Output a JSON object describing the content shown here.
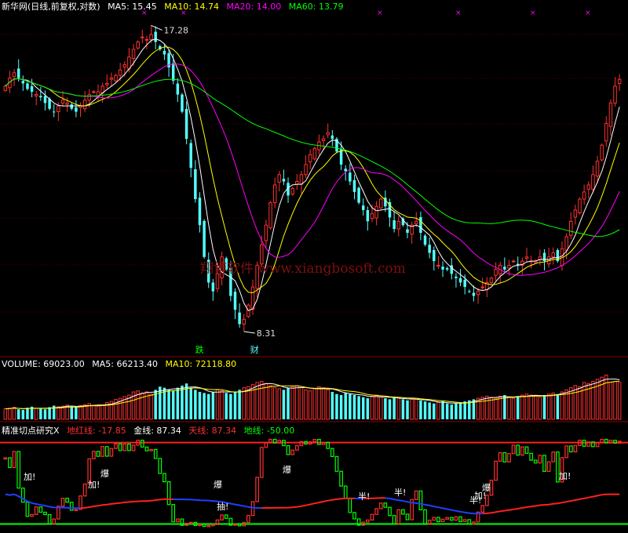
{
  "panels": {
    "price": {
      "title": "新华网(日线,前复权,对数)",
      "ma": [
        {
          "label": "MA5: 15.45",
          "color": "#ffffff"
        },
        {
          "label": "MA10: 14.74",
          "color": "#ffff00"
        },
        {
          "label": "MA20: 14.00",
          "color": "#ff00ff"
        },
        {
          "label": "MA60: 13.79",
          "color": "#00ff00"
        }
      ],
      "high_label": "17.28",
      "low_label": "8.31",
      "marker_die": "跌",
      "marker_cai": "财",
      "watermark": "翔博软件 www.xiangbosoft.com"
    },
    "volume": {
      "items": [
        {
          "label": "VOLUME: 69023.00",
          "color": "#ffffff"
        },
        {
          "label": "MA5: 66213.40",
          "color": "#ffffff"
        },
        {
          "label": "MA10: 72118.80",
          "color": "#ffff00"
        }
      ]
    },
    "indicator": {
      "items": [
        {
          "label": "精准切点研究X",
          "color": "#ffffff"
        },
        {
          "label": "地红线: -17.85",
          "color": "#ff3030"
        },
        {
          "label": "金线: 87.34",
          "color": "#ffffff"
        },
        {
          "label": "天线: 87.34",
          "color": "#ff3030"
        },
        {
          "label": "地线: -50.00",
          "color": "#00ff00"
        }
      ],
      "signals": [
        "加!",
        "加!",
        "爆",
        "爆",
        "爆",
        "抽!",
        "半!",
        "半!",
        "半!",
        "加!",
        "爆",
        "加!"
      ]
    }
  },
  "chart_data": {
    "type": "candlestick",
    "ylim_price": [
      8.0,
      18.2
    ],
    "ylim_indicator": [
      -60,
      100
    ],
    "colors": {
      "up": "#ff3030",
      "down": "#54ffff",
      "ma5": "#ffffff",
      "ma10": "#ffff00",
      "ma20": "#ff00ff",
      "ma60": "#00ff00",
      "heaven": "#ff2020",
      "earth": "#00ff00",
      "blue": "#2040ff"
    },
    "closes": [
      15.2,
      15.5,
      15.7,
      15.5,
      15.3,
      15.1,
      15.0,
      14.9,
      14.8,
      14.6,
      14.4,
      14.3,
      14.5,
      14.7,
      14.6,
      14.4,
      14.3,
      14.5,
      14.7,
      14.9,
      15.0,
      15.0,
      15.2,
      15.3,
      15.5,
      15.6,
      15.8,
      16.0,
      16.3,
      16.6,
      16.9,
      17.1,
      17.0,
      17.2,
      16.9,
      16.6,
      16.4,
      15.9,
      15.4,
      14.9,
      14.3,
      13.4,
      12.5,
      11.6,
      10.9,
      10.1,
      9.5,
      9.3,
      9.7,
      10.1,
      9.8,
      9.2,
      8.9,
      8.6,
      8.7,
      9.0,
      9.4,
      9.9,
      10.4,
      10.9,
      11.5,
      12.0,
      12.3,
      12.1,
      11.7,
      11.9,
      12.1,
      12.3,
      12.6,
      12.9,
      13.1,
      13.3,
      13.4,
      13.6,
      13.4,
      13.0,
      12.6,
      12.4,
      12.1,
      11.8,
      11.5,
      11.3,
      11.0,
      11.2,
      11.4,
      11.6,
      11.4,
      11.1,
      10.8,
      11.0,
      10.9,
      10.7,
      10.9,
      11.0,
      10.7,
      10.4,
      10.2,
      10.0,
      9.9,
      9.8,
      9.8,
      9.7,
      9.6,
      9.5,
      9.4,
      9.3,
      9.2,
      9.3,
      9.4,
      9.5,
      9.6,
      9.8,
      9.9,
      9.8,
      9.9,
      10.0,
      9.9,
      10.0,
      10.1,
      10.0,
      10.0,
      10.1,
      10.0,
      10.1,
      10.2,
      10.0,
      10.3,
      10.6,
      11.0,
      11.3,
      11.6,
      11.8,
      12.0,
      12.3,
      12.7,
      13.2,
      13.9,
      14.6,
      15.2,
      15.45
    ],
    "volumes": [
      200,
      210,
      230,
      190,
      180,
      220,
      240,
      210,
      200,
      190,
      230,
      260,
      240,
      250,
      270,
      240,
      230,
      260,
      280,
      300,
      260,
      250,
      270,
      320,
      340,
      380,
      400,
      430,
      460,
      520,
      540,
      500,
      520,
      480,
      560,
      620,
      600,
      560,
      540,
      600,
      640,
      680,
      600,
      560,
      520,
      500,
      480,
      520,
      560,
      540,
      500,
      480,
      520,
      560,
      600,
      620,
      660,
      700,
      720,
      680,
      640,
      600,
      580,
      560,
      600,
      620,
      640,
      600,
      560,
      540,
      580,
      620,
      600,
      560,
      520,
      480,
      460,
      500,
      480,
      460,
      440,
      420,
      400,
      440,
      460,
      420,
      400,
      380,
      420,
      400,
      380,
      360,
      380,
      400,
      360,
      340,
      320,
      300,
      320,
      340,
      300,
      280,
      300,
      320,
      340,
      360,
      380,
      400,
      420,
      440,
      420,
      400,
      440,
      460,
      420,
      400,
      440,
      460,
      480,
      460,
      440,
      420,
      460,
      480,
      500,
      480,
      520,
      560,
      600,
      640,
      620,
      700,
      680,
      720,
      760,
      800,
      840,
      700,
      720,
      700
    ],
    "heaven_line": 87.34,
    "earth_line": -50.0,
    "red_curve_end": -17.85
  }
}
